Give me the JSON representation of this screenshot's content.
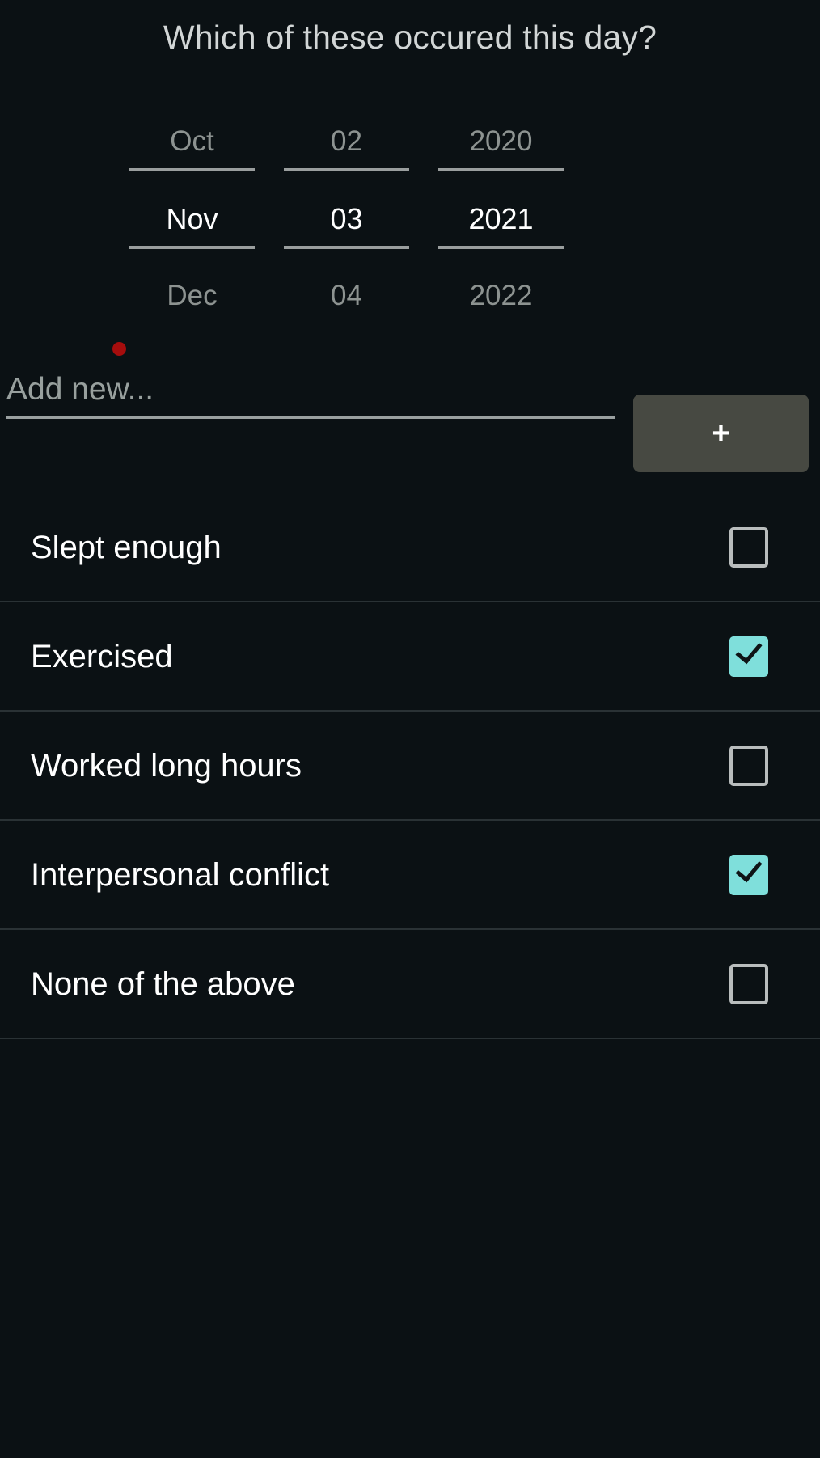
{
  "page": {
    "title": "Which of these occured this day?",
    "background_color": "#0b1114"
  },
  "date_picker": {
    "selected_indicator_color": "#a60d0d",
    "month": {
      "previous": "Oct",
      "current": "Nov",
      "next": "Dec"
    },
    "day": {
      "previous": "02",
      "current": "03",
      "next": "04"
    },
    "year": {
      "previous": "2020",
      "current": "2021",
      "next": "2022"
    }
  },
  "add_new": {
    "placeholder": "Add new...",
    "value": "",
    "button_label": "+",
    "button_color": "#474942"
  },
  "checklist": {
    "checked_color": "#7fdfdb",
    "items": [
      {
        "label": "Slept enough",
        "checked": false
      },
      {
        "label": "Exercised",
        "checked": true
      },
      {
        "label": "Worked long hours",
        "checked": false
      },
      {
        "label": "Interpersonal conflict",
        "checked": true
      },
      {
        "label": "None of the above",
        "checked": false
      }
    ]
  }
}
